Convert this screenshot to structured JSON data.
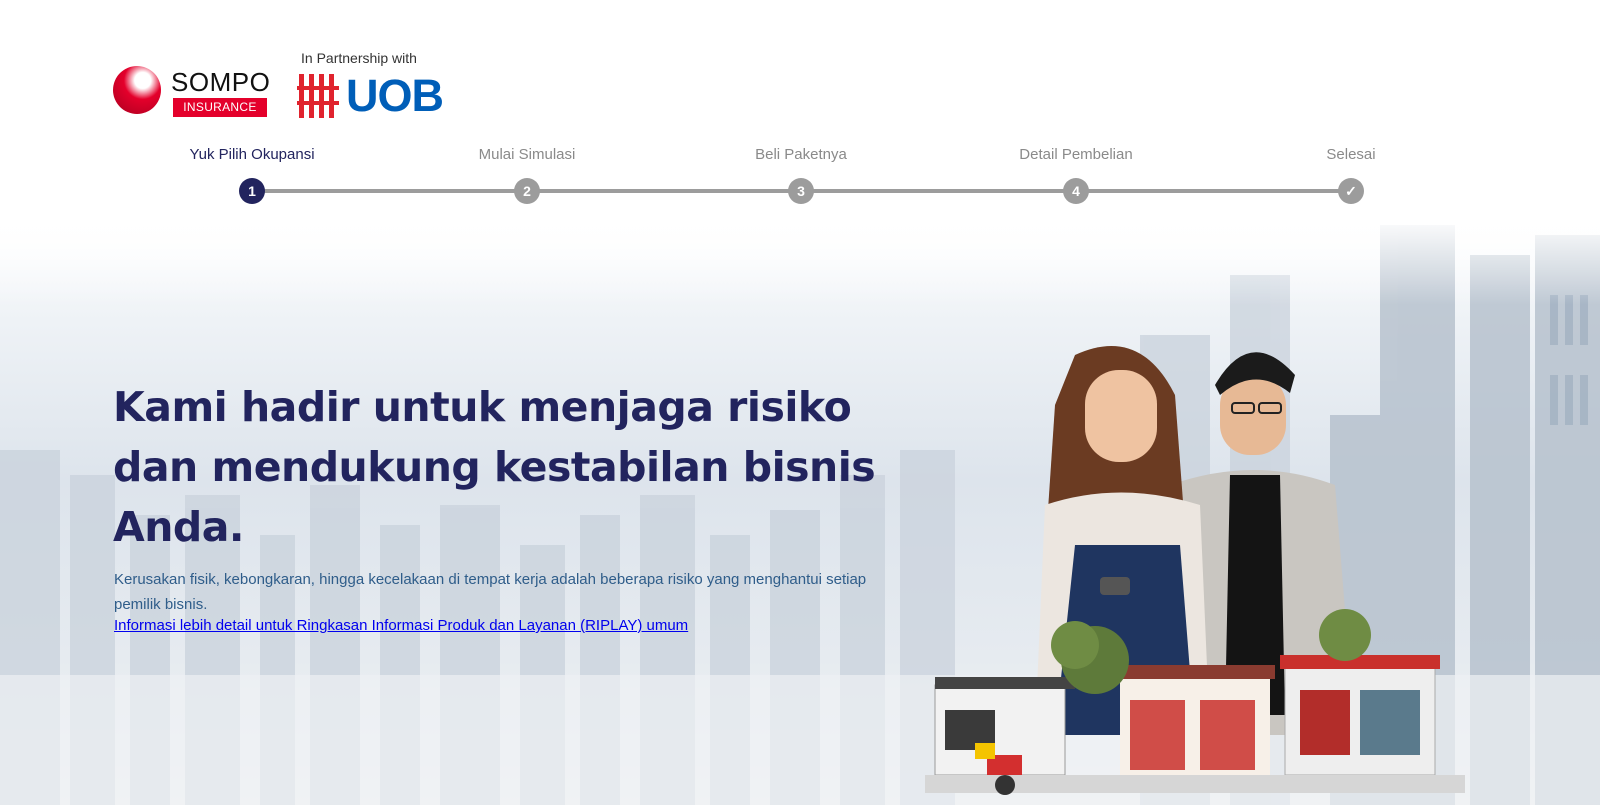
{
  "header": {
    "sompo_logo": {
      "wordmark": "SOMPO",
      "tag": "INSURANCE"
    },
    "partner_text": "In Partnership with",
    "uob_logo": {
      "wordmark": "UOB"
    }
  },
  "stepper": {
    "steps": [
      {
        "label": "Yuk Pilih Okupansi",
        "marker": "1",
        "state": "active"
      },
      {
        "label": "Mulai Simulasi",
        "marker": "2",
        "state": "inactive"
      },
      {
        "label": "Beli Paketnya",
        "marker": "3",
        "state": "inactive"
      },
      {
        "label": "Detail Pembelian",
        "marker": "4",
        "state": "inactive"
      },
      {
        "label": "Selesai",
        "marker": "✓",
        "state": "inactive"
      }
    ]
  },
  "hero": {
    "title": "Kami hadir untuk menjaga risiko dan mendukung kestabilan bisnis Anda.",
    "description": "Kerusakan fisik, kebongkaran, hingga kecelakaan di tempat kerja adalah beberapa risiko yang menghantui setiap pemilik bisnis.",
    "link_text": "Informasi lebih detail untuk Ringkasan Informasi Produk dan Layanan (RIPLAY) umum"
  },
  "colors": {
    "brand_navy": "#22245e",
    "sompo_red": "#e4002b",
    "uob_blue": "#005eb8",
    "uob_red": "#e0232e",
    "step_inactive": "#9c9c9c",
    "link": "#0000ee"
  }
}
